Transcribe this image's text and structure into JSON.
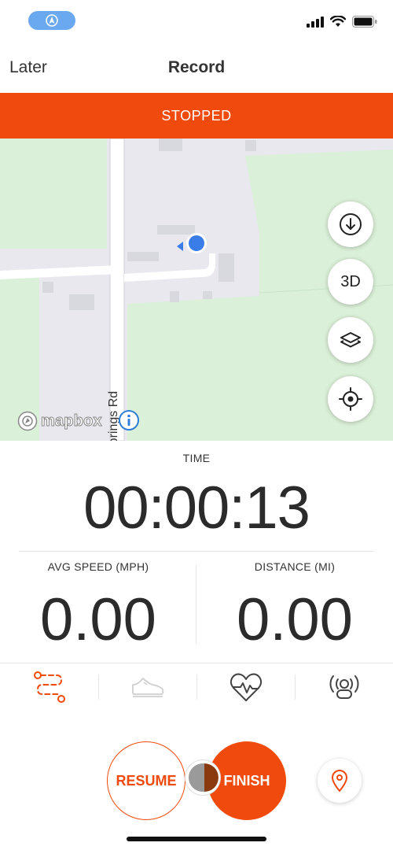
{
  "header": {
    "left_label": "Later",
    "title": "Record"
  },
  "status_banner": {
    "text": "STOPPED",
    "color": "#f04a0c"
  },
  "map": {
    "road_label": "Springs Rd",
    "attribution": "mapbox",
    "buttons": [
      {
        "name": "download-offline-map",
        "icon": "download-icon"
      },
      {
        "name": "3d-view",
        "label": "3D"
      },
      {
        "name": "map-layers",
        "icon": "layers-icon"
      },
      {
        "name": "recenter-location",
        "icon": "crosshair-icon"
      }
    ],
    "land_color": "#dbf0d8",
    "road_color": "#ffffff",
    "location_color": "#3b7de8"
  },
  "stats": {
    "time": {
      "label": "TIME",
      "value": "00:00:13"
    },
    "avg_speed": {
      "label": "AVG SPEED (MPH)",
      "value": "0.00"
    },
    "distance": {
      "label": "DISTANCE (MI)",
      "value": "0.00"
    }
  },
  "tabs": [
    {
      "name": "route",
      "icon": "route-icon",
      "active": true
    },
    {
      "name": "shoes",
      "icon": "shoe-icon",
      "active": false
    },
    {
      "name": "heart-rate",
      "icon": "heart-rate-icon",
      "active": false
    },
    {
      "name": "sensors",
      "icon": "sensor-icon",
      "active": false
    }
  ],
  "controls": {
    "resume_label": "RESUME",
    "finish_label": "FINISH",
    "accent": "#f04a0c"
  }
}
